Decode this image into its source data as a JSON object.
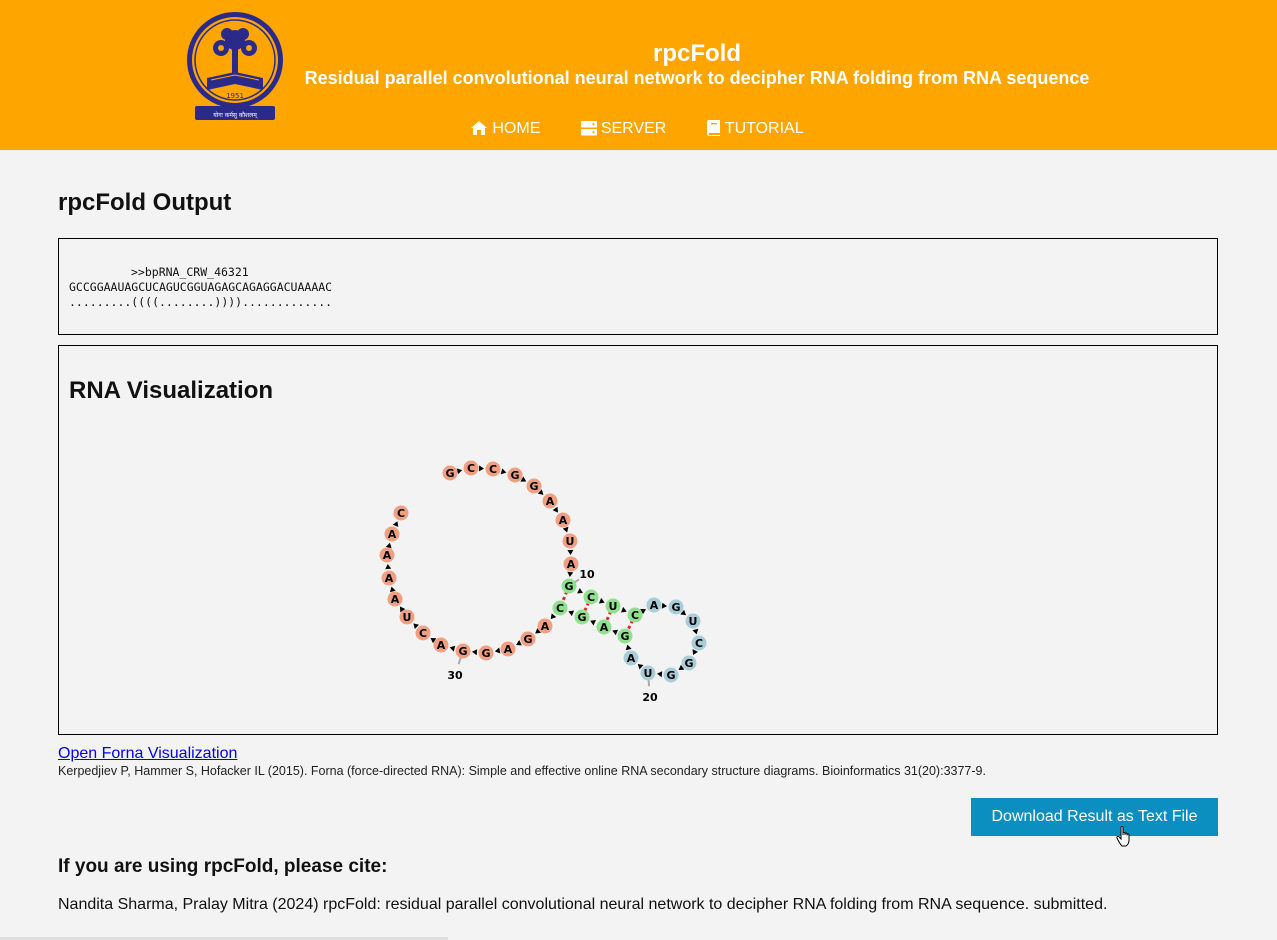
{
  "header": {
    "title": "rpcFold",
    "subtitle": "Residual parallel convolutional neural network to decipher RNA folding from RNA sequence",
    "logo_year": "1951",
    "logo_motto": "योगः कर्मसु कौशलम्",
    "logo_ring": "INDIAN INSTITUTE OF TECHNOLOGY KHARAGPUR",
    "colors": {
      "bar": "#ffa500",
      "text": "#ffffff"
    }
  },
  "nav": {
    "home": "HOME",
    "server": "SERVER",
    "tutorial": "TUTORIAL",
    "icons": [
      "home-icon",
      "server-icon",
      "book-icon"
    ]
  },
  "page": {
    "heading": "rpcFold Output",
    "output_id": ">>bpRNA_CRW_46321",
    "sequence": "GCCGGAAUAGCUCAGUCGGUAGAGCAGAGGACUAAAAC",
    "structure": ".........((((........)))).............",
    "viz_heading": "RNA Visualization",
    "forna_link": "Open Forna Visualization",
    "forna_reference": "Kerpedjiev P, Hammer S, Hofacker IL (2015). Forna (force-directed RNA): Simple and effective online RNA secondary structure diagrams. Bioinformatics 31(20):3377-9.",
    "download_button": "Download Result as Text File",
    "cite_heading": "If you are using rpcFold, please cite:",
    "cite_text": "Nandita Sharma, Pralay Mitra (2024) rpcFold: residual parallel convolutional neural network to decipher RNA folding from RNA sequence. submitted."
  },
  "rna": {
    "nucleotides": [
      "G",
      "C",
      "C",
      "G",
      "G",
      "A",
      "A",
      "U",
      "A",
      "G",
      "C",
      "U",
      "C",
      "A",
      "G",
      "U",
      "C",
      "G",
      "G",
      "U",
      "A",
      "G",
      "A",
      "G",
      "C",
      "A",
      "G",
      "A",
      "G",
      "G",
      "A",
      "C",
      "U",
      "A",
      "A",
      "A",
      "A",
      "C"
    ],
    "number_labels": [
      {
        "index": 10,
        "text": "10"
      },
      {
        "index": 20,
        "text": "20"
      },
      {
        "index": 30,
        "text": "30"
      }
    ],
    "colors": {
      "unpaired": "#f0a080",
      "stem": "#90e090",
      "loop": "#a8ccd8",
      "pair_line": "#ee2222"
    }
  }
}
